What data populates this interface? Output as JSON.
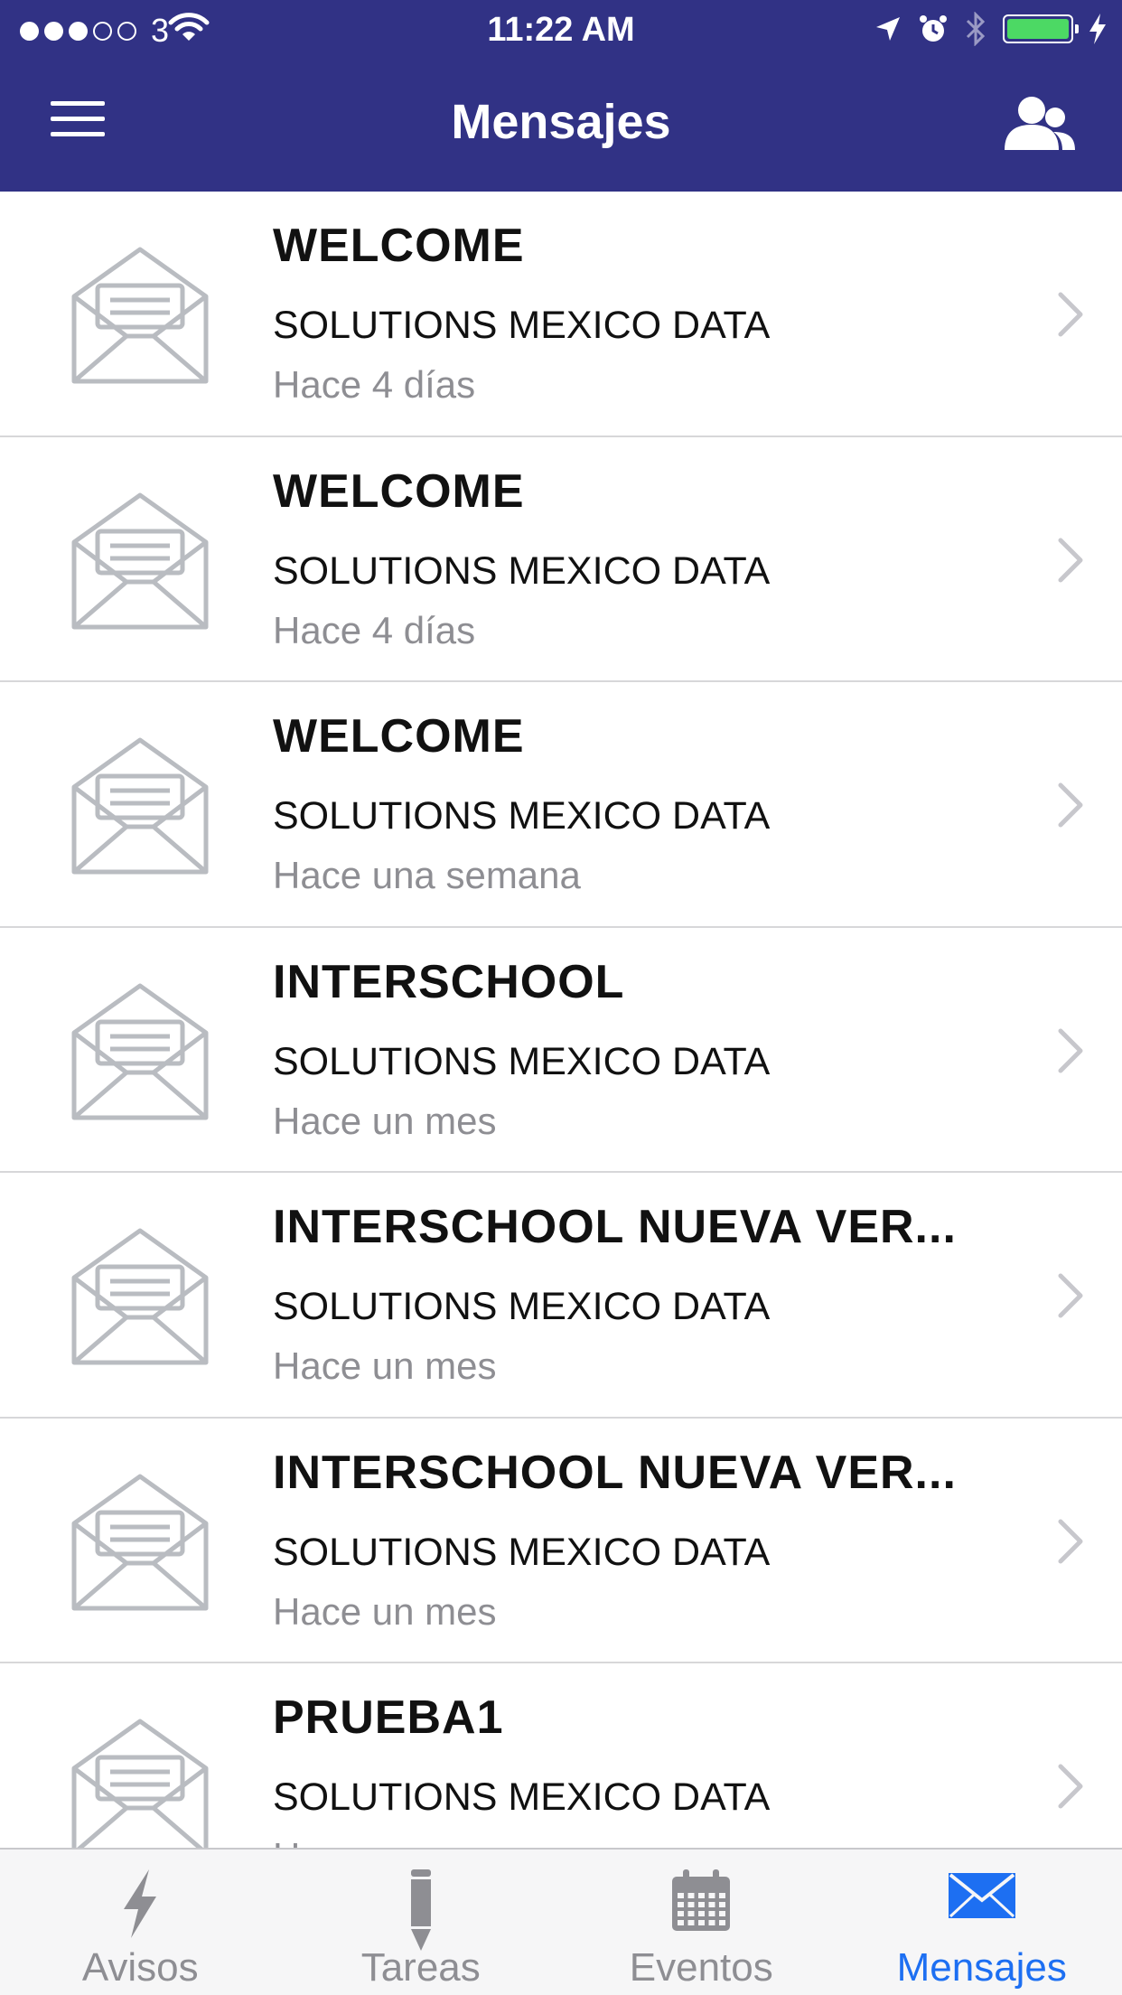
{
  "status_bar": {
    "carrier": "3",
    "time": "11:22 AM",
    "icons": [
      "signal-dots",
      "wifi-icon",
      "location-arrow-icon",
      "alarm-icon",
      "bluetooth-icon",
      "battery-icon",
      "charging-bolt-icon"
    ],
    "battery_color": "#4cd964"
  },
  "nav": {
    "title": "Mensajes",
    "left_icon": "hamburger-menu-icon",
    "right_icon": "contacts-icon",
    "background": "#313285"
  },
  "messages": [
    {
      "title": "WELCOME",
      "sender": "SOLUTIONS MEXICO DATA",
      "time": "Hace 4 días"
    },
    {
      "title": "WELCOME",
      "sender": "SOLUTIONS MEXICO DATA",
      "time": "Hace 4 días"
    },
    {
      "title": "WELCOME",
      "sender": "SOLUTIONS MEXICO DATA",
      "time": "Hace una semana"
    },
    {
      "title": "INTERSCHOOL",
      "sender": "SOLUTIONS MEXICO DATA",
      "time": "Hace un mes"
    },
    {
      "title": "INTERSCHOOL NUEVA VER...",
      "sender": "SOLUTIONS MEXICO DATA",
      "time": "Hace un mes"
    },
    {
      "title": "INTERSCHOOL NUEVA VER...",
      "sender": "SOLUTIONS MEXICO DATA",
      "time": "Hace un mes"
    },
    {
      "title": "PRUEBA1",
      "sender": "SOLUTIONS MEXICO DATA",
      "time": "Hace un mes"
    }
  ],
  "tabs": [
    {
      "label": "Avisos",
      "icon": "lightning-icon",
      "active": false
    },
    {
      "label": "Tareas",
      "icon": "pencil-icon",
      "active": false
    },
    {
      "label": "Eventos",
      "icon": "calendar-icon",
      "active": false
    },
    {
      "label": "Mensajes",
      "icon": "envelope-icon",
      "active": true
    }
  ],
  "colors": {
    "accent": "#1d6ff2",
    "inactive": "#8e8e93",
    "envelope": "#b9bcc1"
  }
}
